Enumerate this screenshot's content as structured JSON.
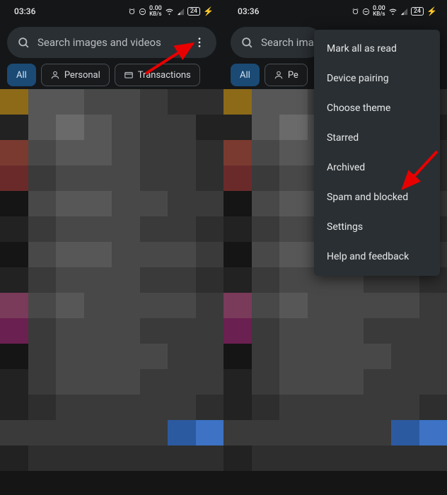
{
  "status": {
    "time": "03:36",
    "kbs_value": "0.00",
    "kbs_unit": "KB/s",
    "battery": "24",
    "charging": "⚡"
  },
  "search": {
    "placeholder": "Search images and videos",
    "placeholder_short": "Search ima"
  },
  "chips": {
    "all": "All",
    "personal": "Personal",
    "personal_short": "Pe",
    "transactions": "Transactions"
  },
  "menu": {
    "mark_read": "Mark all as read",
    "device_pairing": "Device pairing",
    "choose_theme": "Choose theme",
    "starred": "Starred",
    "archived": "Archived",
    "spam_blocked": "Spam and blocked",
    "settings": "Settings",
    "help": "Help and feedback"
  }
}
